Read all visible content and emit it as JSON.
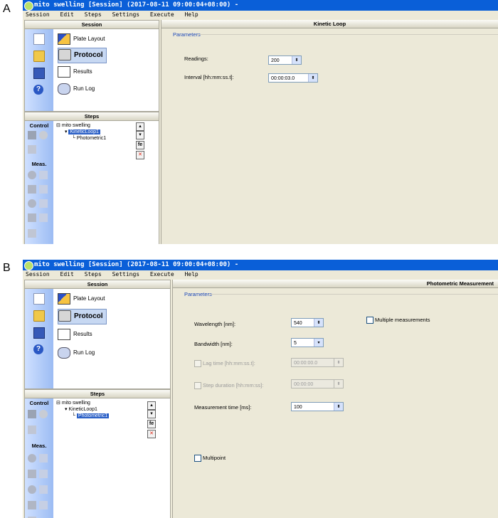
{
  "labels": {
    "a": "A",
    "b": "B"
  },
  "a": {
    "title": "mito swelling [Session] (2017-08-11 09:00:04+08:00) -",
    "menu": [
      "Session",
      "Edit",
      "Steps",
      "Settings",
      "Execute",
      "Help"
    ],
    "session_header": "Session",
    "session_items": [
      "Plate Layout",
      "Protocol",
      "Results",
      "Run Log"
    ],
    "steps_header": "Steps",
    "control_label": "Control",
    "meas_label": "Meas.",
    "tree": [
      "mito swelling",
      "KineticLoop1",
      "Photometric1"
    ],
    "panel_title": "Kinetic Loop",
    "params_legend": "Parameters",
    "readings_label": "Readings:",
    "readings_value": "200",
    "interval_label": "Interval [hh:mm:ss.t]:",
    "interval_value": "00:00:03.0"
  },
  "b": {
    "title": "mito swelling [Session] (2017-08-11 09:00:04+08:00) -",
    "menu": [
      "Session",
      "Edit",
      "Steps",
      "Settings",
      "Execute",
      "Help"
    ],
    "session_header": "Session",
    "session_items": [
      "Plate Layout",
      "Protocol",
      "Results",
      "Run Log"
    ],
    "steps_header": "Steps",
    "control_label": "Control",
    "meas_label": "Meas.",
    "tree": [
      "mito swelling",
      "KineticLoop1",
      "Photometric1"
    ],
    "panel_title": "Photometric Measurement",
    "params_legend": "Parameters",
    "wavelength_label": "Wavelength [nm]:",
    "wavelength_value": "540",
    "bandwidth_label": "Bandwidth [nm]:",
    "bandwidth_value": "5",
    "lag_label": "Lag time [hh:mm:ss.t]:",
    "lag_value": "00:00:00.0",
    "step_label": "Step duration [hh:mm:ss]:",
    "step_value": "00:00:00",
    "meas_time_label": "Measurement time [ms]:",
    "meas_time_value": "100",
    "multiple_label": "Multiple measurements",
    "multipoint_label": "Multipoint"
  }
}
